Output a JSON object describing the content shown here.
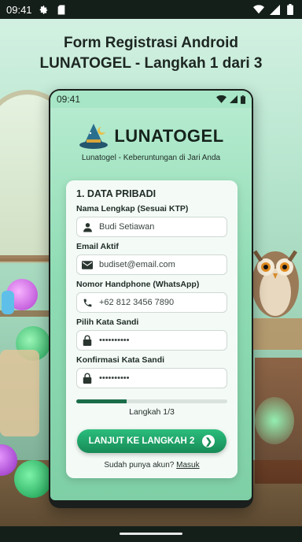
{
  "os_status": {
    "time": "09:41",
    "icons": [
      "settings-icon",
      "sd-card-icon",
      "wifi-icon",
      "signal-icon",
      "battery-icon"
    ]
  },
  "heading": {
    "line1": "Form Registrasi Android",
    "line2": "LUNATOGEL - Langkah 1 dari 3"
  },
  "phone": {
    "status_time": "09:41",
    "brand_name": "LUNATOGEL",
    "tagline": "Lunatogel - Keberuntungan di Jari Anda",
    "form": {
      "section_title": "1. DATA PRIBADI",
      "fields": [
        {
          "label": "Nama Lengkap (Sesuai KTP)",
          "value": "Budi Setiawan",
          "icon": "user-icon"
        },
        {
          "label": "Email Aktif",
          "value": "budiset@email.com",
          "icon": "mail-icon"
        },
        {
          "label": "Nomor Handphone (WhatsApp)",
          "value": "+62 812 3456 7890",
          "icon": "phone-icon"
        },
        {
          "label": "Pilih Kata Sandi",
          "value": "••••••••••",
          "icon": "lock-icon"
        },
        {
          "label": "Konfirmasi Kata Sandi",
          "value": "••••••••••",
          "icon": "lock-icon"
        }
      ],
      "progress_fraction": 0.333,
      "progress_text": "Langkah 1/3",
      "next_button": "LANJUT KE LANGKAH 2",
      "login_prompt": "Sudah punya akun?",
      "login_link": "Masuk"
    }
  },
  "colors": {
    "accent": "#1a8a56",
    "progress": "#1a6d49"
  }
}
